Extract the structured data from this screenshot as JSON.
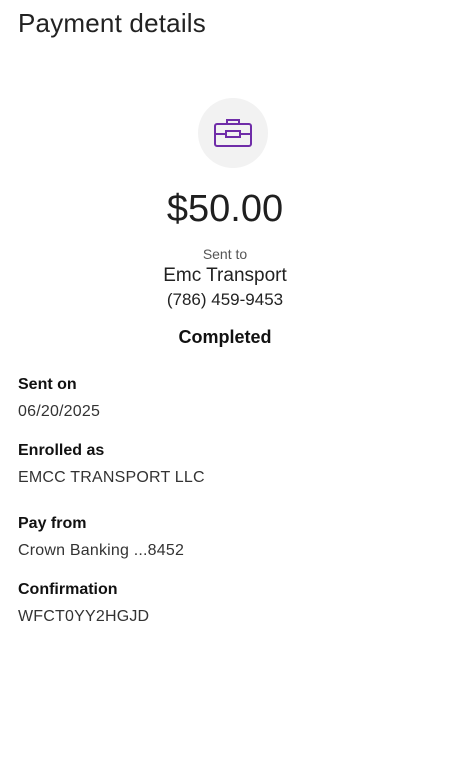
{
  "header": {
    "title": "Payment details"
  },
  "icon": {
    "name": "briefcase-icon",
    "color": "#6f2da8",
    "background": "#f2f2f2"
  },
  "payment": {
    "amount": "$50.00",
    "sent_to_label": "Sent to",
    "recipient_name": "Emc Transport",
    "recipient_phone": "(786) 459-9453",
    "status": "Completed"
  },
  "details": [
    {
      "label": "Sent on",
      "value": "06/20/2025"
    },
    {
      "label": "Enrolled as",
      "value": "EMCC TRANSPORT LLC"
    },
    {
      "label": "Pay from",
      "value": "Crown Banking ...8452"
    },
    {
      "label": "Confirmation",
      "value": "WFCT0YY2HGJD"
    }
  ]
}
